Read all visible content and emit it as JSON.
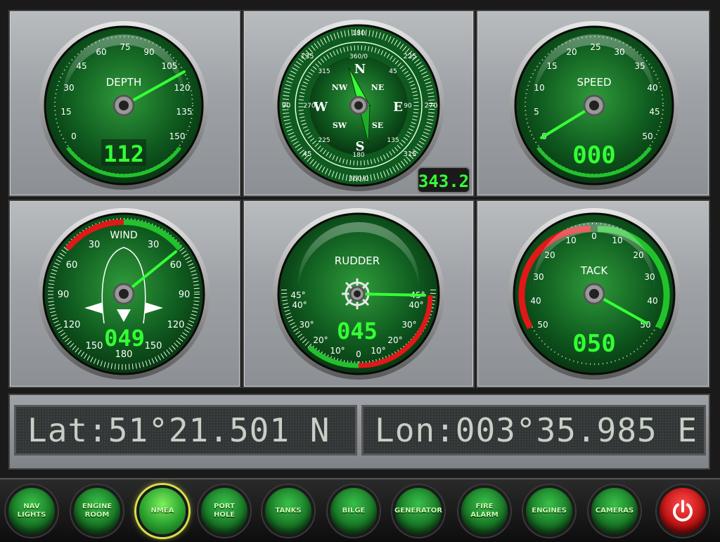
{
  "gauges": {
    "depth": {
      "label": "DEPTH",
      "readout": "112",
      "ticks": [
        "0",
        "15",
        "30",
        "45",
        "60",
        "75",
        "90",
        "105",
        "120",
        "135",
        "150"
      ]
    },
    "compass": {
      "readout": "343.2",
      "cardinals": {
        "n": "N",
        "s": "S",
        "e": "E",
        "w": "W",
        "ne": "NE",
        "nw": "NW",
        "se": "SE",
        "sw": "SW"
      },
      "outer_labels": [
        "180",
        "225",
        "270",
        "315",
        "360/0",
        "45",
        "90",
        "135"
      ],
      "inner_labels": [
        "360/0",
        "45",
        "90",
        "135",
        "180",
        "225",
        "270",
        "315"
      ]
    },
    "speed": {
      "label": "SPEED",
      "readout": "000",
      "ticks": [
        "0",
        "5",
        "10",
        "15",
        "20",
        "25",
        "30",
        "35",
        "40",
        "45",
        "50"
      ]
    },
    "wind": {
      "label": "WIND",
      "readout": "049",
      "left_ticks": [
        "30",
        "60",
        "90",
        "120",
        "150"
      ],
      "right_ticks": [
        "30",
        "60",
        "90",
        "120",
        "150"
      ],
      "bottom": "180"
    },
    "rudder": {
      "label": "RUDDER",
      "readout": "045",
      "left_ticks": [
        "45°",
        "40°",
        "30°",
        "20°",
        "10°"
      ],
      "right_ticks": [
        "45°",
        "40°",
        "30°",
        "20°",
        "10°"
      ],
      "center": "0"
    },
    "tack": {
      "label": "TACK",
      "readout": "050",
      "left_ticks": [
        "10",
        "20",
        "30",
        "40",
        "50"
      ],
      "right_ticks": [
        "10",
        "20",
        "30",
        "40",
        "50"
      ],
      "top": "0"
    }
  },
  "position": {
    "lat": "Lat:51°21.501 N",
    "lon": "Lon:003°35.985 E"
  },
  "buttons": [
    {
      "label": "NAV\nLIGHTS"
    },
    {
      "label": "ENGINE\nROOM"
    },
    {
      "label": "NMEA"
    },
    {
      "label": "PORT\nHOLE"
    },
    {
      "label": "TANKS"
    },
    {
      "label": "BILGE"
    },
    {
      "label": "GENERATOR"
    },
    {
      "label": "FIRE\nALARM"
    },
    {
      "label": "ENGINES"
    },
    {
      "label": "CAMERAS"
    }
  ],
  "colors": {
    "accent": "#35ff35",
    "dial": "#0f5a1f",
    "warn": "#e01818",
    "ok": "#22c22c"
  }
}
